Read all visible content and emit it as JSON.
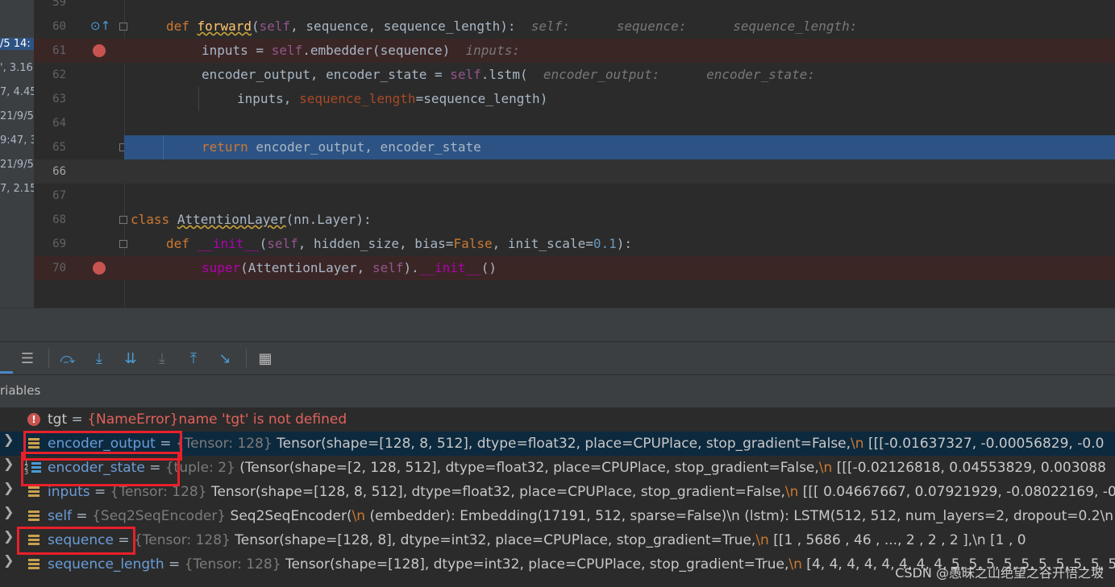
{
  "left_strip": [
    "/5 14:",
    "', 3.16",
    "7, 4.45",
    "21/9/5",
    "9:47, 3",
    "21/9/5",
    "7, 2.15"
  ],
  "editor": {
    "lines": [
      {
        "num": "59"
      },
      {
        "num": "60",
        "hints": [
          "self:",
          "sequence:",
          "sequence_length:"
        ]
      },
      {
        "num": "61",
        "hint": "inputs:"
      },
      {
        "num": "62",
        "hints": [
          "encoder_output:",
          "encoder_state:"
        ]
      },
      {
        "num": "63"
      },
      {
        "num": "64"
      },
      {
        "num": "65"
      },
      {
        "num": "66"
      },
      {
        "num": "67"
      },
      {
        "num": "68"
      },
      {
        "num": "69"
      },
      {
        "num": "70"
      }
    ],
    "code": {
      "l60": {
        "def": "def",
        "name": "forward",
        "open": "(",
        "self": "self",
        "rest": ", sequence, sequence_length):"
      },
      "l61": {
        "a": "inputs = ",
        "self": "self",
        "b": ".embedder(sequence)"
      },
      "l62": {
        "a": "encoder_output, encoder_state = ",
        "self": "self",
        "b": ".lstm("
      },
      "l63": {
        "a": "inputs, ",
        "param": "sequence_length",
        "b": "=sequence_length)"
      },
      "l65": {
        "kw": "return",
        "b": " encoder_output, encoder_state"
      },
      "l68": {
        "kw": "class",
        "name": "AttentionLayer",
        "b": "(nn.Layer):"
      },
      "l69": {
        "def": "def",
        "name": "__init__",
        "open": "(",
        "self": "self",
        "a": ", hidden_size, bias=",
        "false": "False",
        "b": ", init_scale=",
        "num": "0.1",
        "c": "):"
      },
      "l70": {
        "sup": "super",
        "a": "(AttentionLayer, ",
        "self": "self",
        "b": ").",
        "magic": "__init__",
        "c": "()"
      }
    }
  },
  "variables_panel": {
    "title": "riables",
    "rows": [
      {
        "name": "tgt",
        "eq": " = ",
        "type": "{NameError}",
        "value": "name 'tgt' is not defined",
        "error": true
      },
      {
        "name": "encoder_output",
        "eq": " = ",
        "type": "{Tensor: 128}",
        "value": " Tensor(shape=[128, 8, 512], dtype=float32, place=CPUPlace, stop_gradient=False,",
        "nl": "\\n",
        "tail": "       [[[-0.01637327, -0.00056829, -0.0"
      },
      {
        "name": "encoder_state",
        "eq": " = ",
        "type": "{tuple: 2}",
        "value": " (Tensor(shape=[2, 128, 512], dtype=float32, place=CPUPlace, stop_gradient=False,",
        "nl": "\\n",
        "tail": "       [[[-0.02126818,  0.04553829,  0.003088"
      },
      {
        "name": "inputs",
        "eq": " = ",
        "type": "{Tensor: 128}",
        "value": " Tensor(shape=[128, 8, 512], dtype=float32, place=CPUPlace, stop_gradient=False,",
        "nl": "\\n",
        "tail": "       [[[ 0.04667667,  0.07921929, -0.08022169, -0"
      },
      {
        "name": "self",
        "eq": " = ",
        "type": "{Seq2SeqEncoder}",
        "value": " Seq2SeqEncoder(",
        "nl": "\\n",
        "tail": "  (embedder): Embedding(17191, 512, sparse=False)\\n  (lstm): LSTM(512, 512, num_layers=2, dropout=0.2\\n"
      },
      {
        "name": "sequence",
        "eq": " = ",
        "type": "{Tensor: 128}",
        "value": " Tensor(shape=[128, 8], dtype=int32, place=CPUPlace, stop_gradient=True,",
        "nl": "\\n",
        "tail": "       [[1    , 5686 , 46   , ..., 2    , 2    , 2    ],\\n        [1    , 0"
      },
      {
        "name": "sequence_length",
        "eq": " = ",
        "type": "{Tensor: 128}",
        "value": " Tensor(shape=[128], dtype=int32, place=CPUPlace, stop_gradient=True,",
        "nl": "\\n",
        "tail": "       [4, 4, 4, 4, 4, 4, 4, 4, 5, 5, 5, 5, 5, 5, 5, 5, 5, 5,"
      }
    ]
  },
  "watermark": "CSDN @愚昧之山绝望之谷开悟之坡",
  "colors": {
    "selection": "#2d5384",
    "breakpoint": "#c75450",
    "highlight_box": "#e8202a"
  }
}
